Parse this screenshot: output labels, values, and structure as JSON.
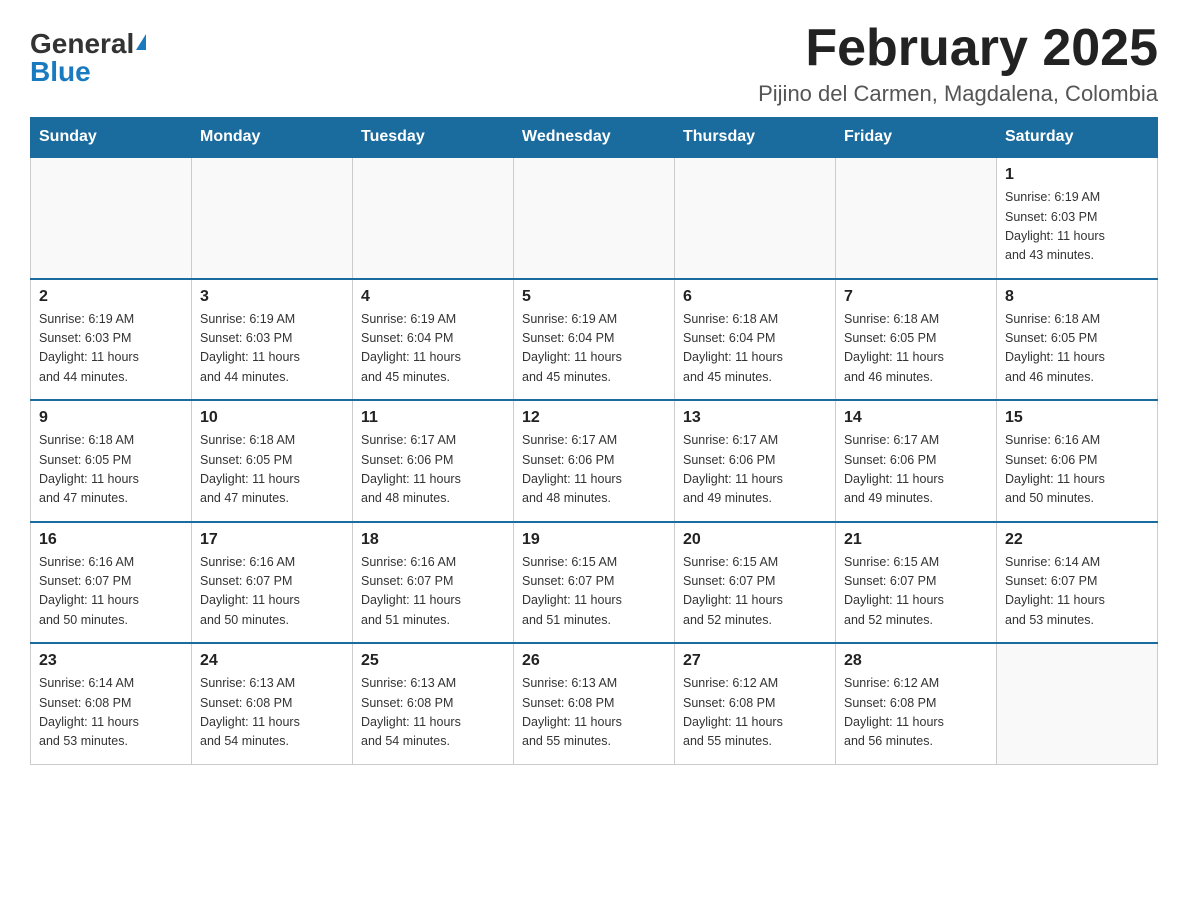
{
  "logo": {
    "general": "General",
    "blue": "Blue",
    "triangle": "▲"
  },
  "title": {
    "month_year": "February 2025",
    "location": "Pijino del Carmen, Magdalena, Colombia"
  },
  "weekdays": [
    "Sunday",
    "Monday",
    "Tuesday",
    "Wednesday",
    "Thursday",
    "Friday",
    "Saturday"
  ],
  "weeks": [
    [
      {
        "day": "",
        "info": ""
      },
      {
        "day": "",
        "info": ""
      },
      {
        "day": "",
        "info": ""
      },
      {
        "day": "",
        "info": ""
      },
      {
        "day": "",
        "info": ""
      },
      {
        "day": "",
        "info": ""
      },
      {
        "day": "1",
        "info": "Sunrise: 6:19 AM\nSunset: 6:03 PM\nDaylight: 11 hours\nand 43 minutes."
      }
    ],
    [
      {
        "day": "2",
        "info": "Sunrise: 6:19 AM\nSunset: 6:03 PM\nDaylight: 11 hours\nand 44 minutes."
      },
      {
        "day": "3",
        "info": "Sunrise: 6:19 AM\nSunset: 6:03 PM\nDaylight: 11 hours\nand 44 minutes."
      },
      {
        "day": "4",
        "info": "Sunrise: 6:19 AM\nSunset: 6:04 PM\nDaylight: 11 hours\nand 45 minutes."
      },
      {
        "day": "5",
        "info": "Sunrise: 6:19 AM\nSunset: 6:04 PM\nDaylight: 11 hours\nand 45 minutes."
      },
      {
        "day": "6",
        "info": "Sunrise: 6:18 AM\nSunset: 6:04 PM\nDaylight: 11 hours\nand 45 minutes."
      },
      {
        "day": "7",
        "info": "Sunrise: 6:18 AM\nSunset: 6:05 PM\nDaylight: 11 hours\nand 46 minutes."
      },
      {
        "day": "8",
        "info": "Sunrise: 6:18 AM\nSunset: 6:05 PM\nDaylight: 11 hours\nand 46 minutes."
      }
    ],
    [
      {
        "day": "9",
        "info": "Sunrise: 6:18 AM\nSunset: 6:05 PM\nDaylight: 11 hours\nand 47 minutes."
      },
      {
        "day": "10",
        "info": "Sunrise: 6:18 AM\nSunset: 6:05 PM\nDaylight: 11 hours\nand 47 minutes."
      },
      {
        "day": "11",
        "info": "Sunrise: 6:17 AM\nSunset: 6:06 PM\nDaylight: 11 hours\nand 48 minutes."
      },
      {
        "day": "12",
        "info": "Sunrise: 6:17 AM\nSunset: 6:06 PM\nDaylight: 11 hours\nand 48 minutes."
      },
      {
        "day": "13",
        "info": "Sunrise: 6:17 AM\nSunset: 6:06 PM\nDaylight: 11 hours\nand 49 minutes."
      },
      {
        "day": "14",
        "info": "Sunrise: 6:17 AM\nSunset: 6:06 PM\nDaylight: 11 hours\nand 49 minutes."
      },
      {
        "day": "15",
        "info": "Sunrise: 6:16 AM\nSunset: 6:06 PM\nDaylight: 11 hours\nand 50 minutes."
      }
    ],
    [
      {
        "day": "16",
        "info": "Sunrise: 6:16 AM\nSunset: 6:07 PM\nDaylight: 11 hours\nand 50 minutes."
      },
      {
        "day": "17",
        "info": "Sunrise: 6:16 AM\nSunset: 6:07 PM\nDaylight: 11 hours\nand 50 minutes."
      },
      {
        "day": "18",
        "info": "Sunrise: 6:16 AM\nSunset: 6:07 PM\nDaylight: 11 hours\nand 51 minutes."
      },
      {
        "day": "19",
        "info": "Sunrise: 6:15 AM\nSunset: 6:07 PM\nDaylight: 11 hours\nand 51 minutes."
      },
      {
        "day": "20",
        "info": "Sunrise: 6:15 AM\nSunset: 6:07 PM\nDaylight: 11 hours\nand 52 minutes."
      },
      {
        "day": "21",
        "info": "Sunrise: 6:15 AM\nSunset: 6:07 PM\nDaylight: 11 hours\nand 52 minutes."
      },
      {
        "day": "22",
        "info": "Sunrise: 6:14 AM\nSunset: 6:07 PM\nDaylight: 11 hours\nand 53 minutes."
      }
    ],
    [
      {
        "day": "23",
        "info": "Sunrise: 6:14 AM\nSunset: 6:08 PM\nDaylight: 11 hours\nand 53 minutes."
      },
      {
        "day": "24",
        "info": "Sunrise: 6:13 AM\nSunset: 6:08 PM\nDaylight: 11 hours\nand 54 minutes."
      },
      {
        "day": "25",
        "info": "Sunrise: 6:13 AM\nSunset: 6:08 PM\nDaylight: 11 hours\nand 54 minutes."
      },
      {
        "day": "26",
        "info": "Sunrise: 6:13 AM\nSunset: 6:08 PM\nDaylight: 11 hours\nand 55 minutes."
      },
      {
        "day": "27",
        "info": "Sunrise: 6:12 AM\nSunset: 6:08 PM\nDaylight: 11 hours\nand 55 minutes."
      },
      {
        "day": "28",
        "info": "Sunrise: 6:12 AM\nSunset: 6:08 PM\nDaylight: 11 hours\nand 56 minutes."
      },
      {
        "day": "",
        "info": ""
      }
    ]
  ]
}
